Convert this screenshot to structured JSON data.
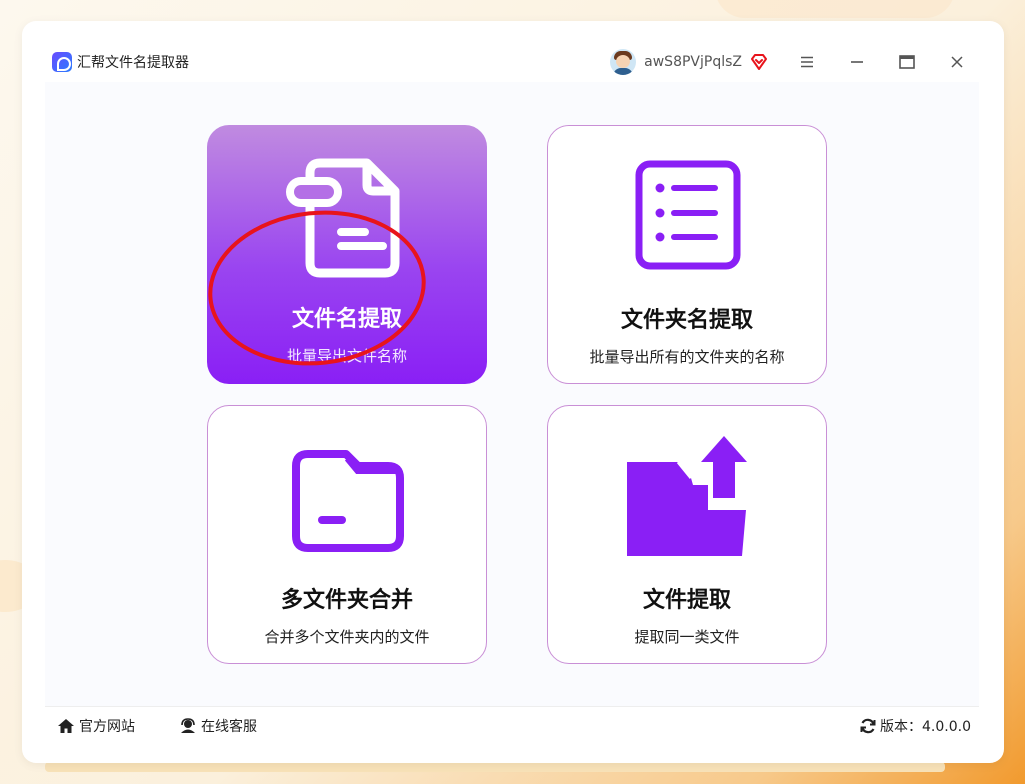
{
  "app": {
    "title": "汇帮文件名提取器"
  },
  "user": {
    "name": "awS8PVjPqlsZ"
  },
  "cards": [
    {
      "title": "文件名提取",
      "subtitle": "批量导出文件名称",
      "icon": "file-document-icon"
    },
    {
      "title": "文件夹名提取",
      "subtitle": "批量导出所有的文件夹的名称",
      "icon": "list-icon"
    },
    {
      "title": "多文件夹合并",
      "subtitle": "合并多个文件夹内的文件",
      "icon": "folder-icon"
    },
    {
      "title": "文件提取",
      "subtitle": "提取同一类文件",
      "icon": "folder-upload-icon"
    }
  ],
  "footer": {
    "website": "官方网站",
    "service": "在线客服",
    "version": "版本：4.0.0.0"
  },
  "colors": {
    "accent": "#8a1ff5",
    "card_border": "#c98fd6",
    "annotation": "#e8141c",
    "vip": "#e8141c"
  }
}
